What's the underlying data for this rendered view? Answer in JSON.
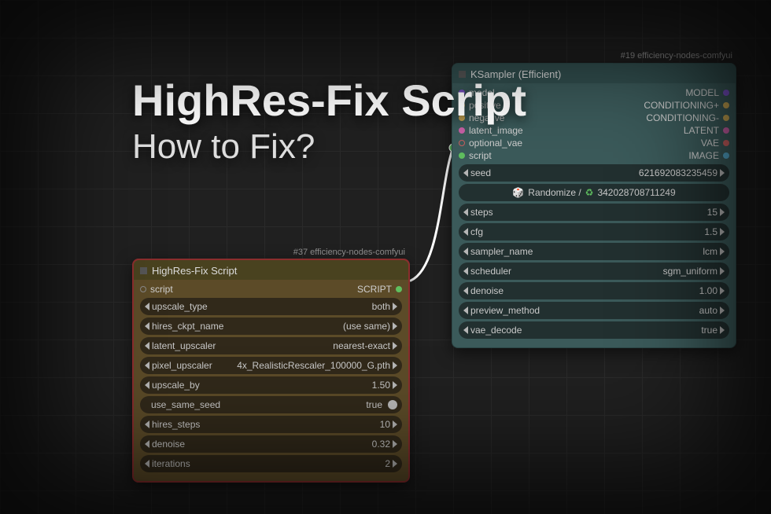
{
  "overlay": {
    "title": "HighRes-Fix Script",
    "subtitle": "How to Fix?"
  },
  "hires": {
    "tag": "#37 efficiency-nodes-comfyui",
    "title": "HighRes-Fix Script",
    "output_port": {
      "label": "script",
      "type_label": "SCRIPT"
    },
    "params": {
      "upscale_type": {
        "label": "upscale_type",
        "value": "both"
      },
      "hires_ckpt": {
        "label": "hires_ckpt_name",
        "value": "(use same)"
      },
      "latent_up": {
        "label": "latent_upscaler",
        "value": "nearest-exact"
      },
      "pixel_up": {
        "label": "pixel_upscaler",
        "value": "4x_RealisticRescaler_100000_G.pth"
      },
      "upscale_by": {
        "label": "upscale_by",
        "value": "1.50"
      },
      "use_same_seed": {
        "label": "use_same_seed",
        "value": "true"
      },
      "hires_steps": {
        "label": "hires_steps",
        "value": "10"
      },
      "denoise": {
        "label": "denoise",
        "value": "0.32"
      },
      "iterations": {
        "label": "iterations",
        "value": "2"
      }
    }
  },
  "ksampler": {
    "tag": "#19 efficiency-nodes-comfyui",
    "title": "KSampler (Efficient)",
    "inputs": {
      "model": {
        "label": "model",
        "color": "#7a52c7"
      },
      "positive": {
        "label": "positive",
        "color": "#c7a552"
      },
      "negative": {
        "label": "negative",
        "color": "#c7a552"
      },
      "latent": {
        "label": "latent_image",
        "color": "#c75fa5"
      },
      "opt_vae": {
        "label": "optional_vae",
        "color": "#c75f5f"
      },
      "script": {
        "label": "script",
        "color": "#5fbf5f"
      }
    },
    "outputs": {
      "model": {
        "label": "MODEL",
        "color": "#7a52c7"
      },
      "cond_pos": {
        "label": "CONDITIONING+",
        "color": "#c7a552"
      },
      "cond_neg": {
        "label": "CONDITIONING-",
        "color": "#c7a552"
      },
      "latent": {
        "label": "LATENT",
        "color": "#c75fa5"
      },
      "vae": {
        "label": "VAE",
        "color": "#c75f5f"
      },
      "image": {
        "label": "IMAGE",
        "color": "#52a5c7"
      }
    },
    "params": {
      "seed": {
        "label": "seed",
        "value": "621692083235459"
      },
      "rand_prefix": "Randomize /",
      "rand_value": "342028708711249",
      "steps": {
        "label": "steps",
        "value": "15"
      },
      "cfg": {
        "label": "cfg",
        "value": "1.5"
      },
      "sampler": {
        "label": "sampler_name",
        "value": "lcm"
      },
      "scheduler": {
        "label": "scheduler",
        "value": "sgm_uniform"
      },
      "denoise": {
        "label": "denoise",
        "value": "1.00"
      },
      "preview": {
        "label": "preview_method",
        "value": "auto"
      },
      "vae_decode": {
        "label": "vae_decode",
        "value": "true"
      }
    }
  }
}
